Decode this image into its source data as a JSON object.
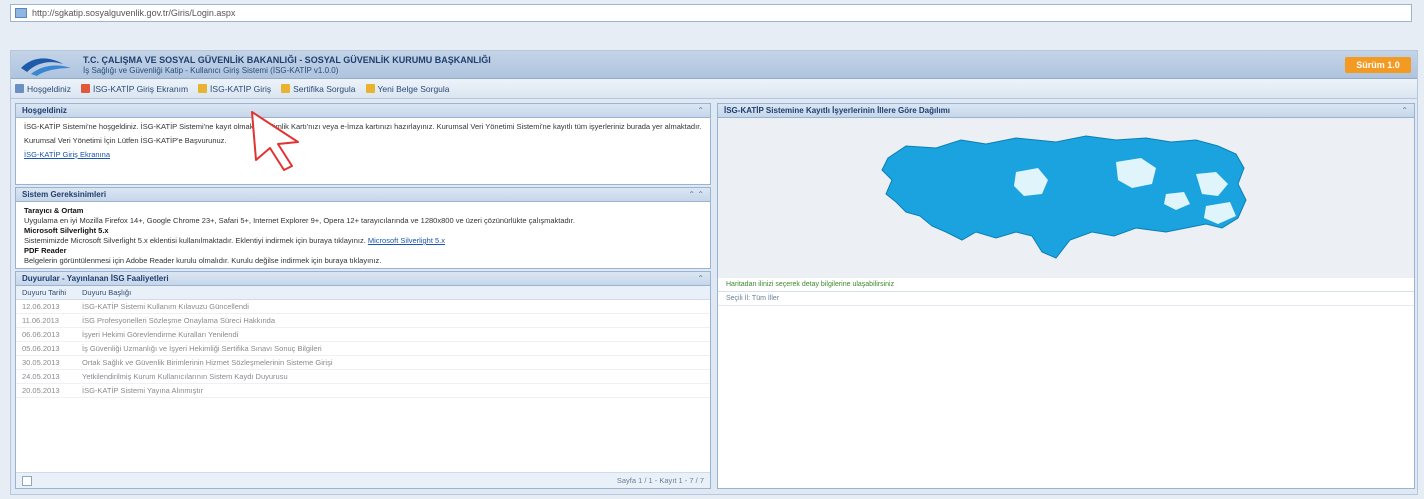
{
  "browser": {
    "url": "http://sgkatip.sosyalguvenlik.gov.tr/Giris/Login.aspx"
  },
  "header": {
    "title": "T.C. ÇALIŞMA VE SOSYAL GÜVENLİK BAKANLIĞI - SOSYAL GÜVENLİK KURUMU BAŞKANLIĞI",
    "subtitle": "İş Sağlığı ve Güvenliği Katip - Kullanıcı Giriş Sistemi (İSG-KATİP v1.0.0)",
    "brand_label": "Sürüm 1.0"
  },
  "toolbar": [
    {
      "label": "Hoşgeldiniz",
      "icon": "home-icon",
      "color": "#6a8fc2"
    },
    {
      "label": "İSG-KATİP Giriş Ekranım",
      "icon": "document-icon",
      "color": "#e05a3a"
    },
    {
      "label": "İSG-KATİP Giriş",
      "icon": "folder-icon",
      "color": "#e8b430"
    },
    {
      "label": "Sertifika Sorgula",
      "icon": "key-icon",
      "color": "#e8b430"
    },
    {
      "label": "Yeni Belge Sorgula",
      "icon": "search-icon",
      "color": "#e8b430"
    }
  ],
  "welcome": {
    "title": "Hoşgeldiniz",
    "para1": "İSG-KATİP Sistemi'ne hoşgeldiniz. İSG-KATİP Sistemi'ne kayıt olmak için Kimlik Kartı'nızı veya e-İmza kartınızı hazırlayınız. Kurumsal Veri Yönetimi Sistemi'ne kayıtlı tüm işyerleriniz burada yer almaktadır.",
    "link_inline": "Kimlik Kartı",
    "para2": "Kurumsal Veri Yönetimi İçin Lütfen İSG-KATİP'e Başvurunuz.",
    "link": "İSG-KATİP Giriş Ekranına"
  },
  "requirements": {
    "title": "Sistem Gereksinimleri",
    "h1": "Tarayıcı & Ortam",
    "p1": "Uygulama en iyi Mozilla Firefox 14+, Google Chrome 23+, Safari 5+, Internet Explorer 9+, Opera 12+ tarayıcılarında ve 1280x800 ve üzeri çözünürlükte çalışmaktadır.",
    "h2": "Microsoft Silverlight 5.x",
    "p2": "Sistemimizde Microsoft Silverlight 5.x eklentisi kullanılmaktadır. Eklentiyi indirmek için buraya tıklayınız.",
    "link2": "Microsoft Silverlight 5.x",
    "h3": "PDF Reader",
    "p3": "Belgelerin görüntülenmesi için Adobe Reader kurulu olmalıdır. Kurulu değilse indirmek için buraya tıklayınız."
  },
  "announcements": {
    "title": "Duyurular - Yayınlanan İSG Faaliyetleri",
    "headers": [
      "Duyuru Tarihi",
      "Duyuru Başlığı"
    ],
    "rows": [
      [
        "12.06.2013",
        "İSG-KATİP Sistemi Kullanım Kılavuzu Güncellendi"
      ],
      [
        "11.06.2013",
        "İSG Profesyonelleri Sözleşme Onaylama Süreci Hakkında"
      ],
      [
        "06.06.2013",
        "İşyeri Hekimi Görevlendirme Kuralları Yenilendi"
      ],
      [
        "05.06.2013",
        "İş Güvenliği Uzmanlığı ve İşyeri Hekimliği Sertifika Sınavı Sonuç Bilgileri"
      ],
      [
        "30.05.2013",
        "Ortak Sağlık ve Güvenlik Birimlerinin Hizmet Sözleşmelerinin Sisteme Girişi"
      ],
      [
        "24.05.2013",
        "Yetkilendirilmiş Kurum Kullanıcılarının Sistem Kaydı Duyurusu"
      ],
      [
        "20.05.2013",
        "İSG-KATİP Sistemi Yayına Alınmıştır"
      ]
    ],
    "pager_text": "Sayfa 1 / 1 - Kayıt 1 - 7 / 7"
  },
  "map_panel": {
    "title": "İSG-KATİP Sistemine Kayıtlı İşyerlerinin İllere Göre Dağılımı",
    "caption": "Haritadan ilinizi seçerek detay bilgilerine ulaşabilirsiniz",
    "selected": "Seçili İl: Tüm İller",
    "fill_color": "#1aa3de",
    "highlight_color": "#dff4fb"
  }
}
